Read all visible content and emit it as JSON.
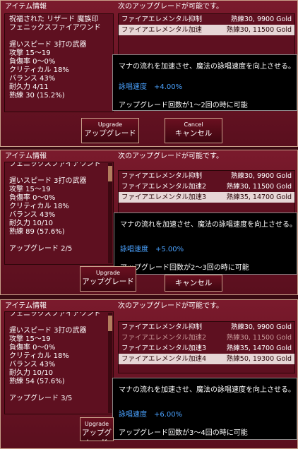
{
  "panels": [
    {
      "left_header": "アイテム情報",
      "right_header": "次のアップグレードが可能です。",
      "info_lines": [
        "祝福された リザード 魔族印",
        "フェニックスファイアワンド",
        "",
        "遅いスピード 3打の武器",
        "攻撃 15～19",
        "負傷率 0～0%",
        "クリティカル 18%",
        "バランス 43%",
        "耐久力 4/11",
        "熟練 30 (15.2%)"
      ],
      "upgrades": [
        {
          "name": "ファイアエレメンタル抑制",
          "req": "熟練30, 9900 Gold",
          "state": "normal"
        },
        {
          "name": "ファイアエレメンタル加速",
          "req": "熟練30, 11500 Gold",
          "state": "selected"
        }
      ],
      "tooltip": {
        "desc": "マナの流れを加速させ、魔法の詠唱速度を向上させる。",
        "stat_name": "詠唱速度",
        "stat_value": "+4.00%",
        "cond": "アップグレード回数が1～2回の時に可能"
      },
      "upgrade_btn": {
        "en": "Upgrade",
        "jp": "アップグレード"
      },
      "cancel_btn": {
        "en": "Cancel",
        "jp": "キャンセル"
      }
    },
    {
      "left_header": "アイテム情報",
      "right_header": "次のアップグレードが可能です。",
      "info_lines": [
        "フェニックスファイアワンド",
        "",
        "遅いスピード 3打の武器",
        "攻撃 15～19",
        "負傷率 0～0%",
        "クリティカル 18%",
        "バランス 43%",
        "耐久力 10/10",
        "熟練 89 (57.6%)",
        "",
        "アップグレード 2/5"
      ],
      "upgrades": [
        {
          "name": "ファイアエレメンタル抑制",
          "req": "熟練30, 9900 Gold",
          "state": "normal"
        },
        {
          "name": "ファイアエレメンタル加速2",
          "req": "熟練30, 11500 Gold",
          "state": "normal"
        },
        {
          "name": "ファイアエレメンタル加速3",
          "req": "熟練35, 14700 Gold",
          "state": "selected"
        }
      ],
      "tooltip": {
        "desc": "マナの流れを加速させ、魔法の詠唱速度を向上させる。",
        "stat_name": "詠唱速度",
        "stat_value": "+5.00%",
        "cond": "アップグレード回数が2～3回の時に可能"
      },
      "upgrade_btn": {
        "en": "Upgrade",
        "jp": "アップグレード"
      },
      "cancel_btn": {
        "en": "",
        "jp": "キャンセル"
      }
    },
    {
      "left_header": "アイテム情報",
      "right_header": "次のアップグレードが可能です。",
      "info_lines": [
        "フェニックスファイアワンド",
        "",
        "遅いスピード 3打の武器",
        "攻撃 15～19",
        "負傷率 0～0%",
        "クリティカル 18%",
        "バランス 43%",
        "耐久力 10/10",
        "熟練 54 (57.6%)",
        "",
        "アップグレード 3/5"
      ],
      "upgrades": [
        {
          "name": "ファイアエレメンタル抑制",
          "req": "熟練30, 9900 Gold",
          "state": "normal"
        },
        {
          "name": "ファイアエレメンタル加速2",
          "req": "熟練30, 11500 Gold",
          "state": "dim"
        },
        {
          "name": "ファイアエレメンタル加速3",
          "req": "熟練35, 14700 Gold",
          "state": "normal"
        },
        {
          "name": "ファイアエレメンタル加速4",
          "req": "熟練50, 19300 Gold",
          "state": "selected"
        }
      ],
      "tooltip": {
        "desc": "マナの流れを加速させ、魔法の詠唱速度を向上させる。",
        "stat_name": "詠唱速度",
        "stat_value": "+6.00%",
        "cond": "アップグレード回数が3～4回の時に可能"
      },
      "upgrade_btn": {
        "en": "Upgrade",
        "jp": "アップグレード"
      },
      "cancel_btn": {
        "en": "",
        "jp": ""
      }
    }
  ]
}
